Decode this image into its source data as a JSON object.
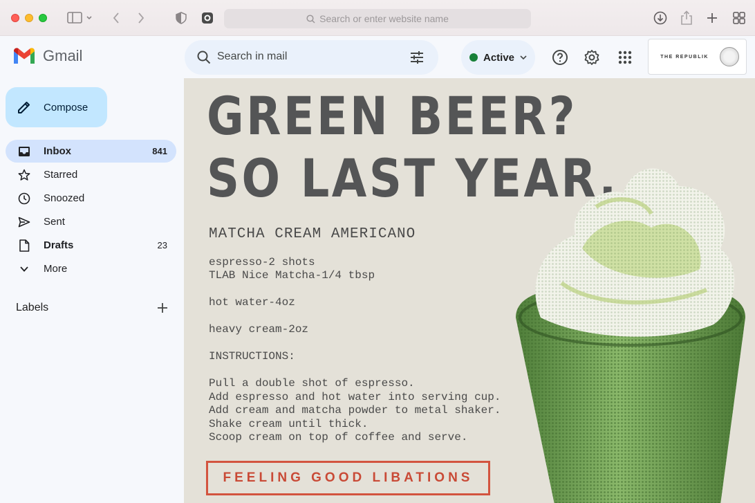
{
  "browser": {
    "url_placeholder": "Search or enter website name"
  },
  "gmail": {
    "app_name": "Gmail",
    "search_placeholder": "Search in mail",
    "status": "Active",
    "account_brand": "THE REPUBLIK",
    "compose_label": "Compose",
    "nav": [
      {
        "label": "Inbox",
        "count": "841",
        "icon": "inbox-icon",
        "active": true,
        "bold": true
      },
      {
        "label": "Starred",
        "count": "",
        "icon": "star-icon",
        "active": false,
        "bold": false
      },
      {
        "label": "Snoozed",
        "count": "",
        "icon": "clock-icon",
        "active": false,
        "bold": false
      },
      {
        "label": "Sent",
        "count": "",
        "icon": "send-icon",
        "active": false,
        "bold": false
      },
      {
        "label": "Drafts",
        "count": "23",
        "icon": "draft-icon",
        "active": false,
        "bold": true
      },
      {
        "label": "More",
        "count": "",
        "icon": "chevron-down-icon",
        "active": false,
        "bold": false
      }
    ],
    "labels_heading": "Labels"
  },
  "email": {
    "headline_line1": "GREEN BEER?",
    "headline_line2": "SO LAST YEAR.",
    "recipe_title": "MATCHA CREAM AMERICANO",
    "ingredients_1": "espresso-2 shots",
    "ingredients_2": "TLAB Nice Matcha-1/4 tbsp",
    "ingredients_3": "hot water-4oz",
    "ingredients_4": "heavy cream-2oz",
    "instructions_heading": "INSTRUCTIONS:",
    "step_1": "Pull a double shot of espresso.",
    "step_2": "Add espresso and hot water into serving cup.",
    "step_3": "Add cream and matcha powder to metal shaker.",
    "step_4": "Shake cream until thick.",
    "step_5": "Scoop cream on top of coffee and serve.",
    "cta": "FEELING GOOD LIBATIONS"
  },
  "colors": {
    "compose_bg": "#c2e7ff",
    "inbox_active_bg": "#d3e3fd",
    "email_bg": "#e4e1d8",
    "cta_red": "#d3543f",
    "status_green": "#188038"
  }
}
